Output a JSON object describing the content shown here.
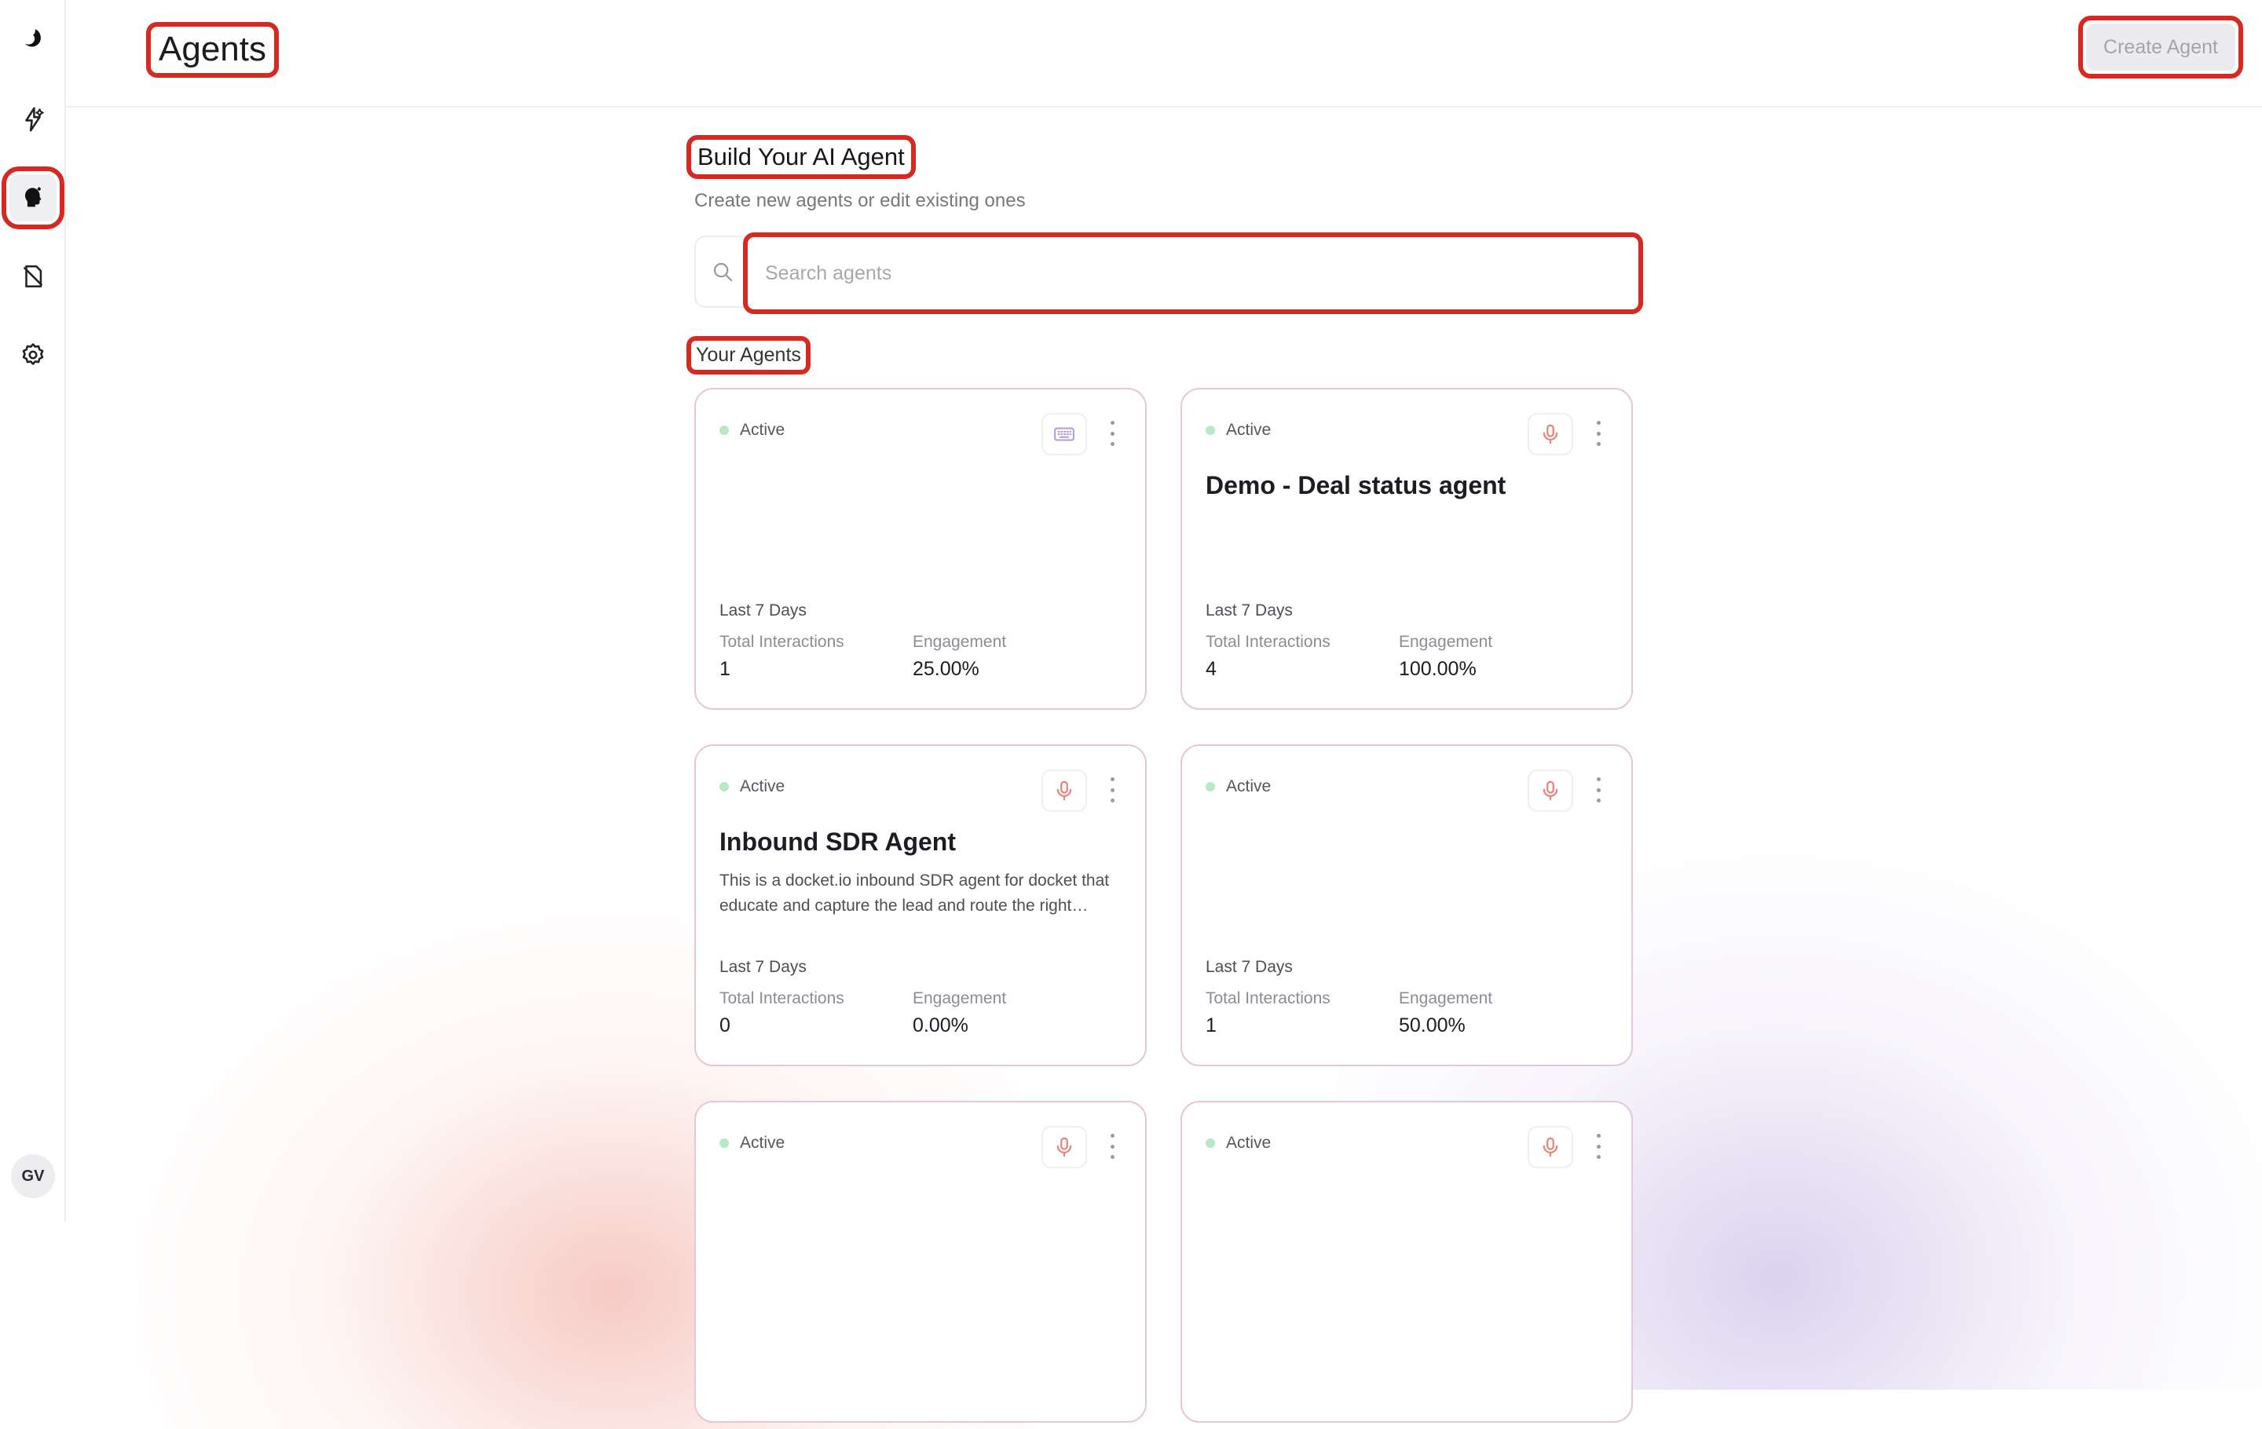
{
  "header": {
    "title": "Agents",
    "create_button": "Create Agent"
  },
  "sidebar": {
    "items": [
      {
        "name": "logo",
        "icon": "brand-logo-icon"
      },
      {
        "name": "automations",
        "icon": "sparkle-icon"
      },
      {
        "name": "agents",
        "icon": "agent-head-icon",
        "active": true
      },
      {
        "name": "documents",
        "icon": "document-off-icon"
      },
      {
        "name": "settings",
        "icon": "gear-icon"
      }
    ],
    "avatar_initials": "GV"
  },
  "main": {
    "title": "Build Your AI Agent",
    "subtitle": "Create new agents or edit existing ones",
    "search": {
      "placeholder": "Search agents",
      "value": ""
    },
    "agents_heading": "Your Agents"
  },
  "cards": [
    {
      "status": "Active",
      "type": "keyboard-icon",
      "name": "",
      "description": "",
      "period": "Last 7 Days",
      "interactions_label": "Total Interactions",
      "interactions": "1",
      "engagement_label": "Engagement",
      "engagement": "25.00%"
    },
    {
      "status": "Active",
      "type": "microphone-icon",
      "name": "Demo - Deal status agent",
      "description": "",
      "period": "Last 7 Days",
      "interactions_label": "Total Interactions",
      "interactions": "4",
      "engagement_label": "Engagement",
      "engagement": "100.00%"
    },
    {
      "status": "Active",
      "type": "microphone-icon",
      "name": "Inbound SDR Agent",
      "description": "This is a docket.io inbound SDR agent for docket that educate and capture the lead and route the right accounts to meetings",
      "period": "Last 7 Days",
      "interactions_label": "Total Interactions",
      "interactions": "0",
      "engagement_label": "Engagement",
      "engagement": "0.00%"
    },
    {
      "status": "Active",
      "type": "microphone-icon",
      "name": "",
      "description": "",
      "period": "Last 7 Days",
      "interactions_label": "Total Interactions",
      "interactions": "1",
      "engagement_label": "Engagement",
      "engagement": "50.00%"
    },
    {
      "status": "Active",
      "type": "microphone-icon",
      "name": "",
      "description": "",
      "period": "",
      "interactions_label": "",
      "interactions": "",
      "engagement_label": "",
      "engagement": ""
    },
    {
      "status": "Active",
      "type": "microphone-icon",
      "name": "",
      "description": "",
      "period": "",
      "interactions_label": "",
      "interactions": "",
      "engagement_label": "",
      "engagement": ""
    }
  ],
  "colors": {
    "highlight": "#d62a20",
    "active_dot": "#b8e9c4",
    "mic": "#e8847a",
    "keyboard": "#b39ad8",
    "card_border": "#e6c6d8"
  }
}
